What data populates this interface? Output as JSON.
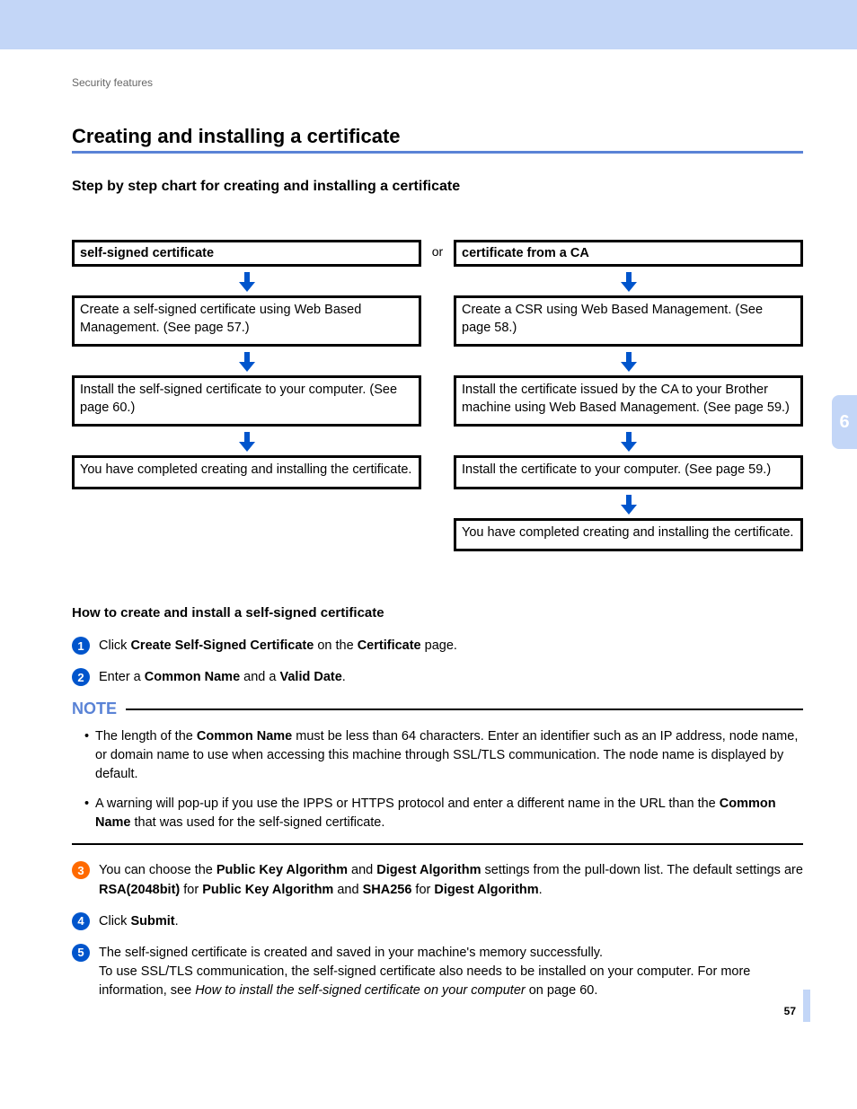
{
  "breadcrumb": "Security features",
  "page_title": "Creating and installing a certificate",
  "sub_title": "Step by step chart for creating and installing a certificate",
  "chart": {
    "or": "or",
    "left": {
      "header": "self-signed certificate",
      "steps": [
        "Create a self-signed certificate using Web Based Management. (See page 57.)",
        "Install the self-signed certificate to your computer. (See page 60.)",
        "You have completed creating and installing the certificate."
      ]
    },
    "right": {
      "header": "certificate from a CA",
      "steps": [
        "Create a CSR using Web Based Management. (See page 58.)",
        "Install the certificate issued by the CA to your Brother machine using Web Based Management. (See page 59.)",
        "Install the certificate to your computer. (See page 59.)",
        "You have completed creating and installing the certificate."
      ]
    }
  },
  "howto_title": "How to create and install a self-signed certificate",
  "steps": {
    "s1_a": "Click ",
    "s1_b": "Create Self-Signed Certificate",
    "s1_c": " on the ",
    "s1_d": "Certificate",
    "s1_e": " page.",
    "s2_a": "Enter a ",
    "s2_b": "Common Name",
    "s2_c": " and a ",
    "s2_d": "Valid Date",
    "s2_e": ".",
    "s3_a": "You can choose the ",
    "s3_b": "Public Key Algorithm",
    "s3_c": " and ",
    "s3_d": "Digest Algorithm",
    "s3_e": " settings from the pull-down list. The default settings are ",
    "s3_f": "RSA(2048bit)",
    "s3_g": " for ",
    "s3_h": "Public Key Algorithm",
    "s3_i": " and ",
    "s3_j": "SHA256",
    "s3_k": " for ",
    "s3_l": "Digest Algorithm",
    "s3_m": ".",
    "s4_a": "Click ",
    "s4_b": "Submit",
    "s4_c": ".",
    "s5_a": "The self-signed certificate is created and saved in your machine's memory successfully.",
    "s5_b": "To use SSL/TLS communication, the self-signed certificate also needs to be installed on your computer. For more information, see ",
    "s5_c": "How to install the self-signed certificate on your computer",
    "s5_d": " on page 60."
  },
  "note_label": "NOTE",
  "notes": {
    "n1_a": "The length of the ",
    "n1_b": "Common Name",
    "n1_c": " must be less than 64 characters. Enter an identifier such as an IP address, node name, or domain name to use when accessing this machine through SSL/TLS communication. The node name is displayed by default.",
    "n2_a": "A warning will pop-up if you use the IPPS or HTTPS protocol and enter a different name in the URL than the ",
    "n2_b": "Common Name",
    "n2_c": " that was used for the self-signed certificate."
  },
  "side_tab": "6",
  "page_number": "57"
}
